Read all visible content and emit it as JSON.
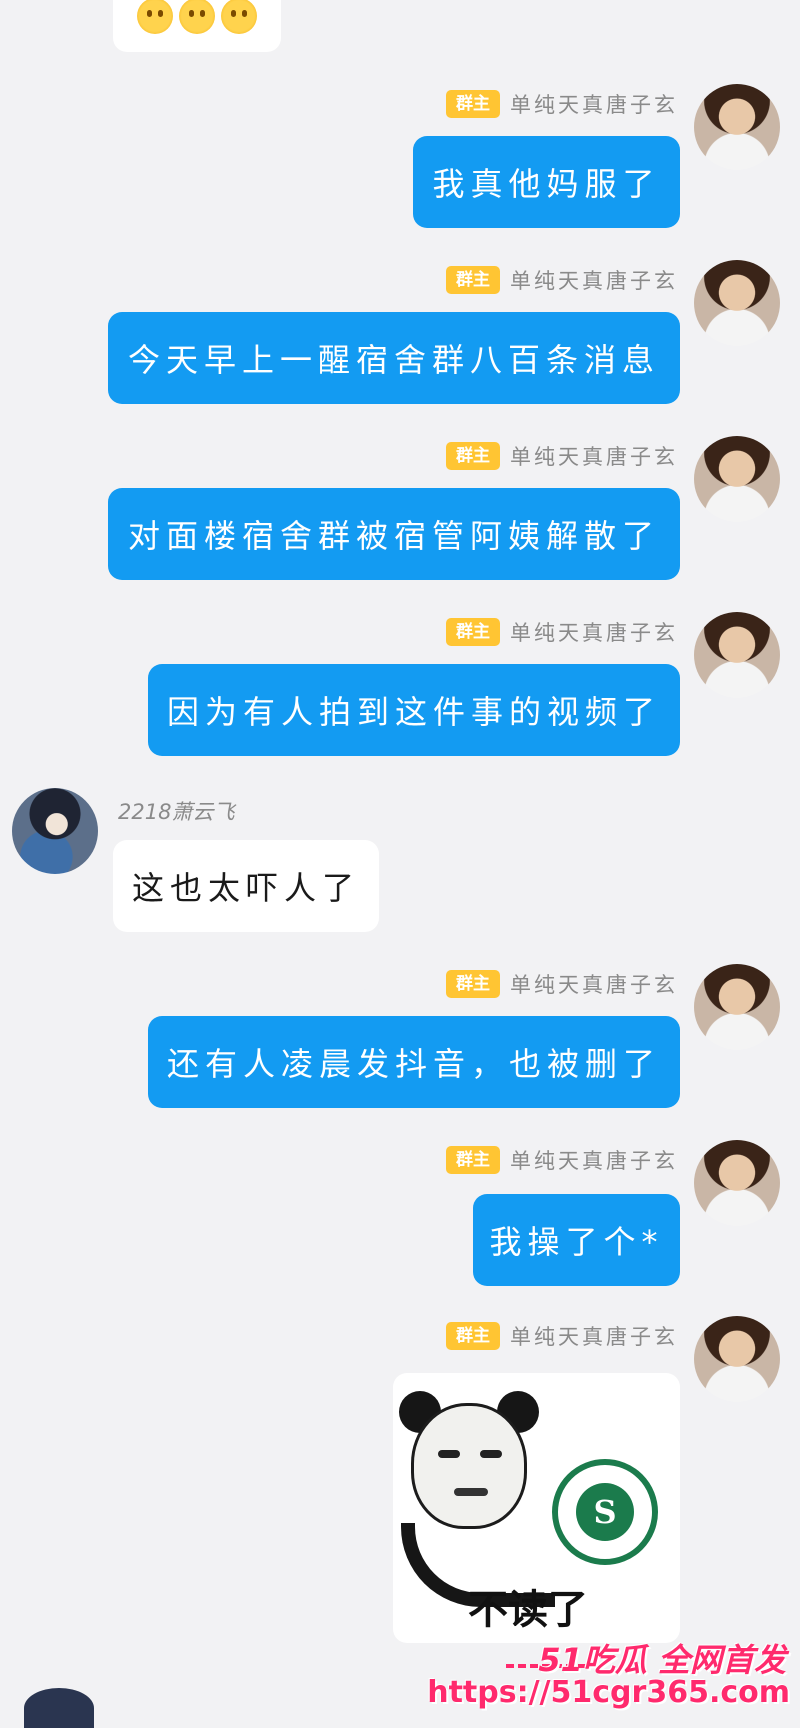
{
  "top": {
    "emojis": [
      "smiley-icon",
      "smiley-icon",
      "smiley-icon"
    ]
  },
  "role_badge": "群主",
  "owner_name": "单纯天真唐子玄",
  "messages": [
    {
      "text": "我真他妈服了"
    },
    {
      "text": "今天早上一醒宿舍群八百条消息"
    },
    {
      "text": "对面楼宿舍群被宿管阿姨解散了"
    },
    {
      "text": "因为有人拍到这件事的视频了"
    },
    {
      "sender": "2218萧云飞",
      "text": "这也太吓人了"
    },
    {
      "text": "还有人凌晨发抖音，也被删了"
    },
    {
      "text": "我操了个*"
    },
    {
      "image_caption": "不读了"
    }
  ],
  "watermark": {
    "line1": "51吃瓜 全网首发",
    "line2": "https://51cgr365.com"
  },
  "colors": {
    "bubble_blue": "#139bf2",
    "badge": "#ffc533",
    "background": "#f2f2f4"
  }
}
